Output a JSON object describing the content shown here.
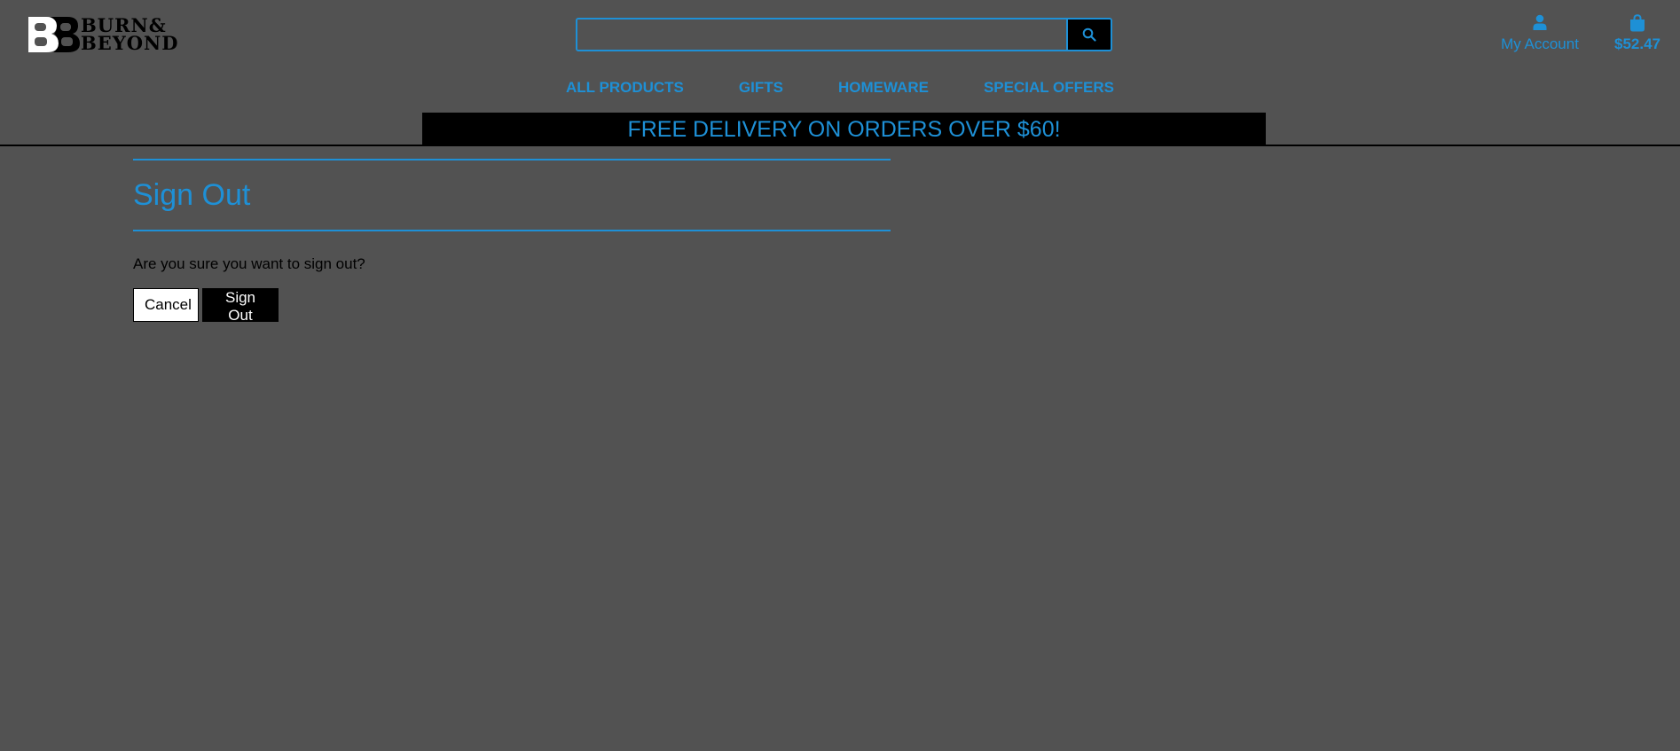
{
  "logo": {
    "mark": "BB",
    "line1": "BURN&",
    "line2": "BEYOND"
  },
  "search": {
    "value": "",
    "placeholder": "",
    "icon": "search-icon"
  },
  "account": {
    "label": "My Account",
    "icon": "user-icon"
  },
  "cart": {
    "total": "$52.47",
    "icon": "shopping-bag-icon"
  },
  "nav": {
    "items": [
      {
        "label": "ALL PRODUCTS"
      },
      {
        "label": "GIFTS"
      },
      {
        "label": "HOMEWARE"
      },
      {
        "label": "SPECIAL OFFERS"
      }
    ]
  },
  "banner": {
    "text": "FREE DELIVERY ON ORDERS OVER $60!"
  },
  "signout": {
    "title": "Sign Out",
    "prompt": "Are you sure you want to sign out?",
    "cancel_label": "Cancel",
    "confirm_label": "Sign Out"
  },
  "colors": {
    "background": "#525252",
    "accent": "#1e90d6",
    "dark": "#000000"
  }
}
